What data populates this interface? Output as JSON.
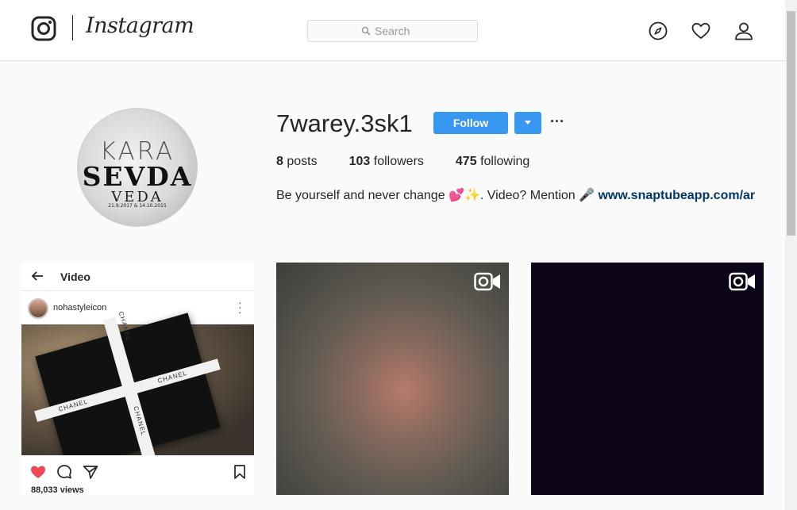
{
  "nav": {
    "wordmark": "Instagram",
    "search_placeholder": "Search",
    "icons": [
      "instagram-glyph-icon",
      "search-icon",
      "compass-icon",
      "heart-icon",
      "person-icon"
    ]
  },
  "profile": {
    "username": "7warey.3sk1",
    "follow_label": "Follow",
    "more_label": "···",
    "avatar_text": {
      "line1": "KARA",
      "line2": "SEVDA",
      "line3": "VEDA",
      "line4": "21.9.2017 & 14.10.2015"
    },
    "stats": {
      "posts_count": "8",
      "posts_label": "posts",
      "followers_count": "103",
      "followers_label": "followers",
      "following_count": "475",
      "following_label": "following"
    },
    "bio_text": "Be yourself and never change 💕✨. Video? Mention 🎤 ",
    "bio_link": "www.snaptubeapp.com/ar"
  },
  "posts": [
    {
      "type": "video",
      "inner": {
        "title": "Video",
        "user": "nohastyleicon",
        "views": "88,033 views",
        "brand": "CHANEL"
      }
    },
    {
      "type": "video"
    },
    {
      "type": "video"
    }
  ],
  "colors": {
    "accent": "#3897f0",
    "link": "#003569",
    "background": "#fafafa",
    "border": "#dbdbdb"
  }
}
